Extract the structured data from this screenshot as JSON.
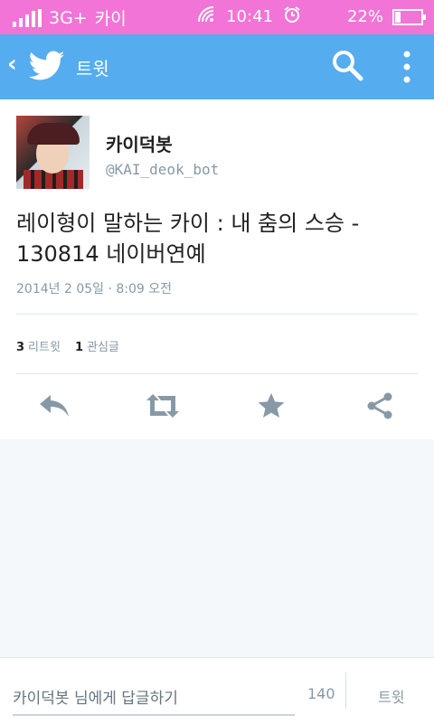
{
  "status_bar": {
    "network": "3G+",
    "carrier": "카이",
    "time": "10:41",
    "battery": "22%"
  },
  "app_bar": {
    "title": "트윗"
  },
  "tweet": {
    "user": {
      "name": "카이덕봇",
      "handle": "@KAI_deok_bot"
    },
    "text": "레이형이 말하는 카이 : 내 춤의 스승 - 130814 네이버연예",
    "timestamp": "2014년 2 05일 · 8:09 오전",
    "retweets": {
      "count": "3",
      "label": "리트윗"
    },
    "favorites": {
      "count": "1",
      "label": "관심글"
    }
  },
  "composer": {
    "placeholder": "카이덕봇 님에게 답글하기",
    "char_count": "140",
    "send_label": "트윗"
  },
  "colors": {
    "status_bar": "#f274d6",
    "app_bar": "#55acee",
    "action_icon": "#8899a6"
  }
}
